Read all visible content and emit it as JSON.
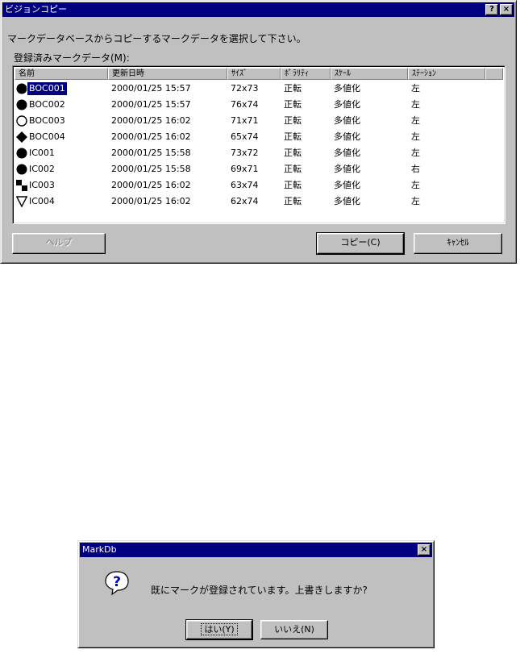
{
  "dialog1": {
    "title": "ビジョンコピー",
    "help_icon": "?",
    "close_icon": "×",
    "instruction": "マークデータベースからコピーするマークデータを選択して下さい。",
    "list_label": "登録済みマークデータ(M):",
    "columns": [
      "名前",
      "更新日時",
      "ｻｲｽﾞ",
      "ﾎﾟﾗﾘﾃｨ",
      "ｽｹｰﾙ",
      "ｽﾃｰｼｮﾝ"
    ],
    "rows": [
      {
        "icon": "circle-filled-icon",
        "name": "BOC001",
        "date": "2000/01/25 15:57",
        "size": "72x73",
        "polarity": "正転",
        "scale": "多値化",
        "station": "左"
      },
      {
        "icon": "circle-filled-icon",
        "name": "BOC002",
        "date": "2000/01/25 15:57",
        "size": "76x74",
        "polarity": "正転",
        "scale": "多値化",
        "station": "左"
      },
      {
        "icon": "circle-outline-icon",
        "name": "BOC003",
        "date": "2000/01/25 16:02",
        "size": "71x71",
        "polarity": "正転",
        "scale": "多値化",
        "station": "左"
      },
      {
        "icon": "diamond-filled-icon",
        "name": "BOC004",
        "date": "2000/01/25 16:02",
        "size": "65x74",
        "polarity": "正転",
        "scale": "多値化",
        "station": "左"
      },
      {
        "icon": "circle-filled-icon",
        "name": "IC001",
        "date": "2000/01/25 15:58",
        "size": "73x72",
        "polarity": "正転",
        "scale": "多値化",
        "station": "左"
      },
      {
        "icon": "circle-filled-icon",
        "name": "IC002",
        "date": "2000/01/25 15:58",
        "size": "69x71",
        "polarity": "正転",
        "scale": "多値化",
        "station": "右"
      },
      {
        "icon": "checker-square-icon",
        "name": "IC003",
        "date": "2000/01/25 16:02",
        "size": "63x74",
        "polarity": "正転",
        "scale": "多値化",
        "station": "左"
      },
      {
        "icon": "triangle-down-outline-icon",
        "name": "IC004",
        "date": "2000/01/25 16:02",
        "size": "62x74",
        "polarity": "正転",
        "scale": "多値化",
        "station": "左"
      }
    ],
    "selected_row": 0,
    "help_button": "ヘルプ",
    "copy_button": "コピー(C)",
    "cancel_button": "ｷｬﾝｾﾙ"
  },
  "dialog2": {
    "title": "MarkDb",
    "close_icon": "×",
    "question_icon": "?",
    "message": "既にマークが登録されています。上書きしますか?",
    "yes_button": "はい(Y)",
    "no_button": "いいえ(N)"
  },
  "colors": {
    "titlebar": "#000080",
    "face": "#c0c0c0",
    "selection": "#000080",
    "question_icon": "#0000c0"
  }
}
